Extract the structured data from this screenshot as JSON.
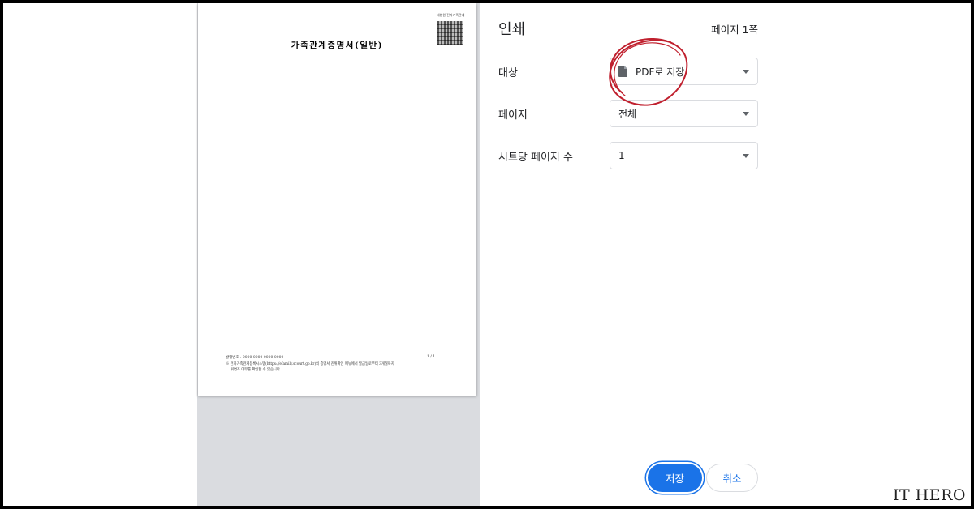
{
  "preview": {
    "document_title": "가족관계증명서(일반)",
    "qr_header": "대법원 전자가족관계",
    "issue_number": "발행번호 : 0000-0000-0000-0000",
    "page_indicator": "1 / 1",
    "footer_note": "※ 전자가족관계등록시스템(https://efamily.scourt.go.kr)의 증명서 진위확인 메뉴에서 발급일로부터 3개월까지",
    "footer_note2": "위변조 여부를 확인할 수 있습니다."
  },
  "panel": {
    "title": "인쇄",
    "page_count": "페이지 1쪽",
    "destination": {
      "label": "대상",
      "value": "PDF로 저장",
      "icon": "document-icon"
    },
    "pages": {
      "label": "페이지",
      "value": "전체"
    },
    "pages_per_sheet": {
      "label": "시트당 페이지 수",
      "value": "1"
    },
    "save_button": "저장",
    "cancel_button": "취소"
  },
  "annotation_color": "#c0202e",
  "accent_color": "#1a73e8",
  "watermark": "IT HERO"
}
